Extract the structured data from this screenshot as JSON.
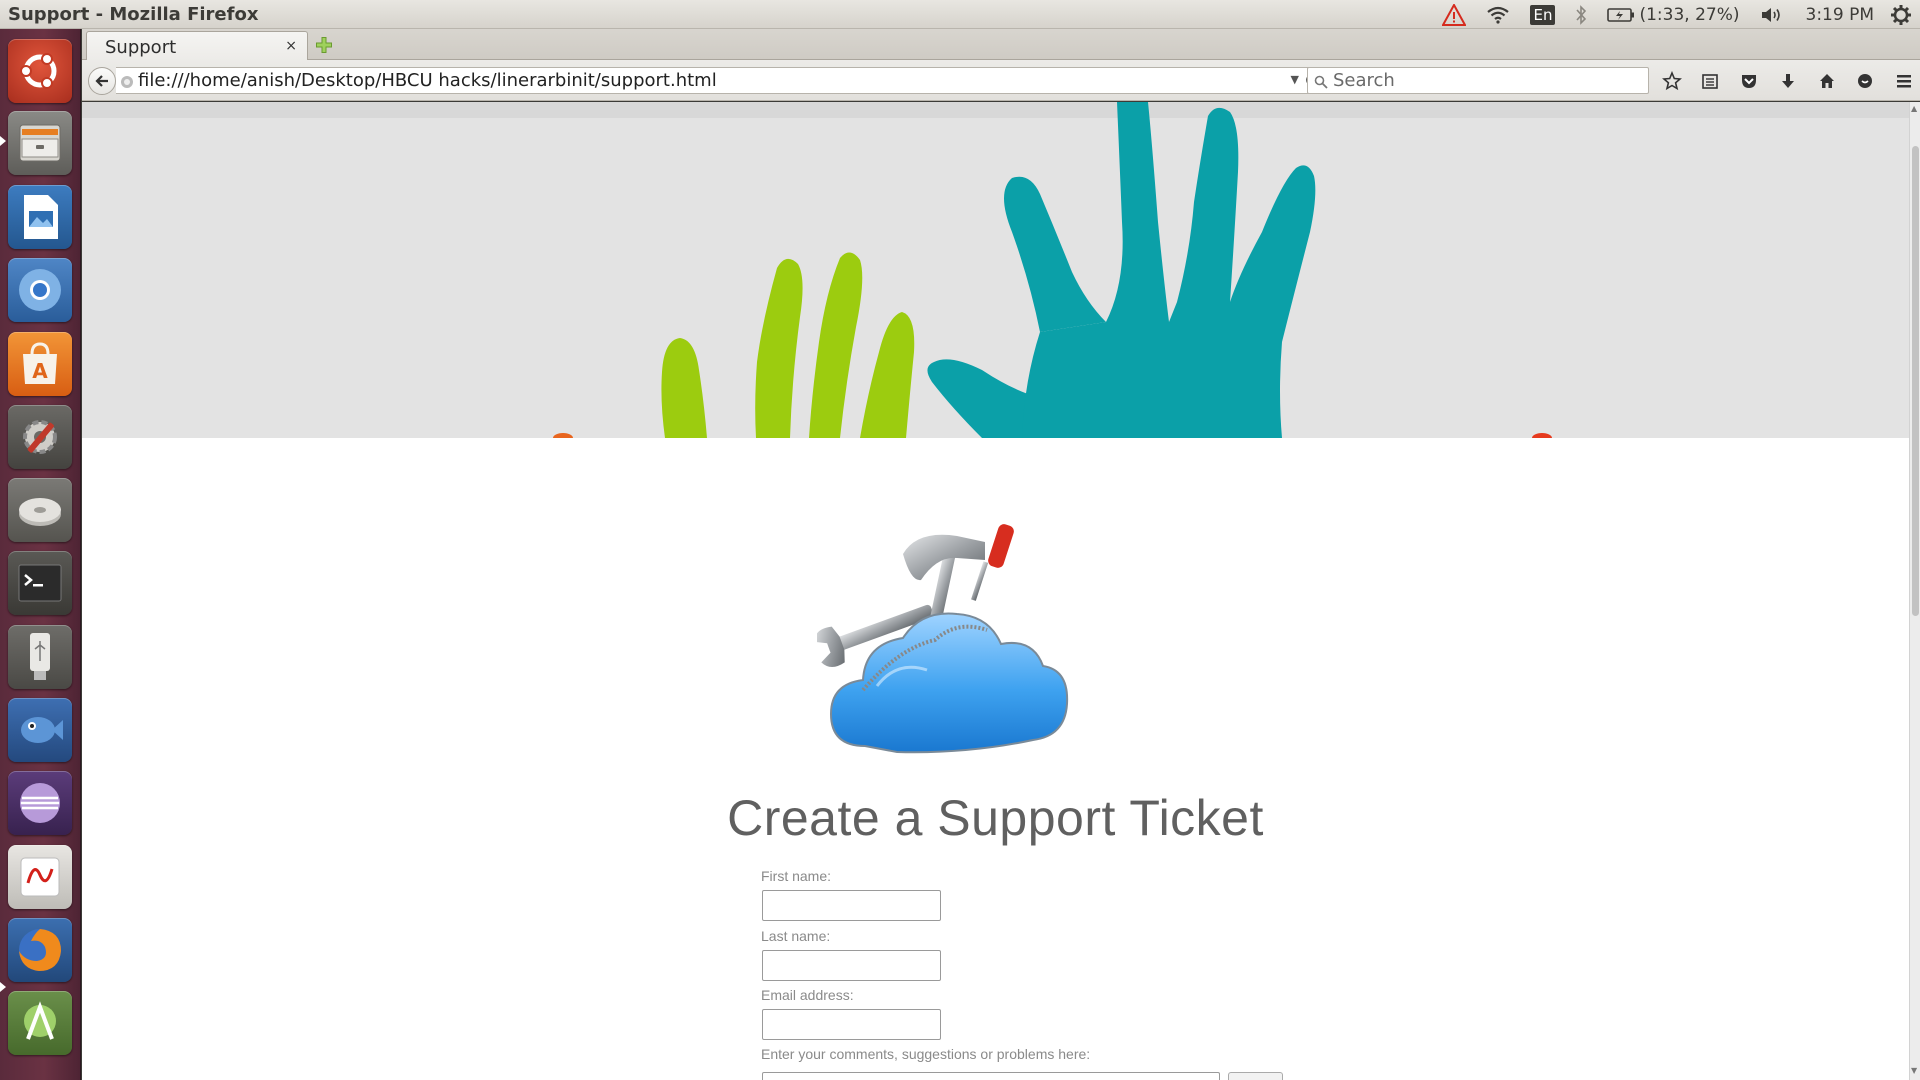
{
  "window": {
    "title": "Support - Mozilla Firefox"
  },
  "indicators": {
    "language": "En",
    "battery": "(1:33, 27%)",
    "clock": "3:19 PM"
  },
  "launcher": {
    "items": [
      "Ubuntu dash",
      "Files",
      "LibreOffice Impress",
      "Chromium",
      "Ubuntu Software Center",
      "System Settings",
      "Disk",
      "Terminal",
      "USB drive",
      "Empathy",
      "Eclipse",
      "Adobe Reader",
      "Firefox",
      "Android Studio"
    ]
  },
  "tabs": [
    {
      "label": "Support",
      "close": "×"
    }
  ],
  "navbar": {
    "url": "file:///home/anish/Desktop/HBCU hacks/linerarbinit/support.html",
    "search_placeholder": "Search"
  },
  "page": {
    "heading": "Create a Support Ticket",
    "form": {
      "first_name_label": "First name:",
      "last_name_label": "Last name:",
      "email_label": "Email address:",
      "comments_label": "Enter your comments, suggestions or problems here:"
    }
  },
  "colors": {
    "hand_green": "#9ccc0f",
    "hand_teal": "#0ba0a8",
    "hero_bg": "#e3e3e3",
    "heading": "#606060",
    "launcher_bg": "#5a2b3c"
  }
}
